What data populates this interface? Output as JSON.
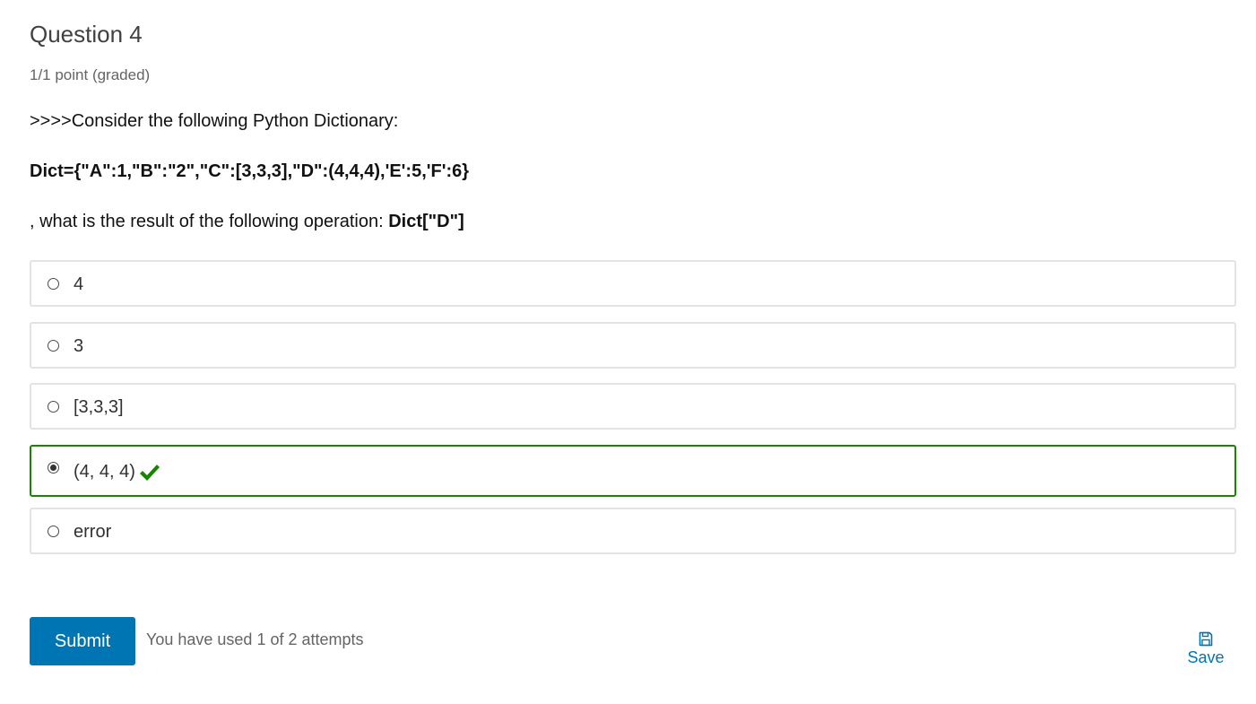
{
  "question": {
    "title": "Question 4",
    "points": "1/1 point (graded)",
    "intro": ">>>>Consider the following Python Dictionary:",
    "code": "Dict={\"A\":1,\"B\":\"2\",\"C\":[3,3,3],\"D\":(4,4,4),'E':5,'F':6}",
    "prompt_prefix": ", what is the result of the following operation: ",
    "prompt_expression": "Dict[\"D\"]"
  },
  "choices": [
    {
      "label": "4",
      "selected": false,
      "correct": false
    },
    {
      "label": "3",
      "selected": false,
      "correct": false
    },
    {
      "label": "[3,3,3]",
      "selected": false,
      "correct": false
    },
    {
      "label": "(4, 4, 4)",
      "selected": true,
      "correct": true
    },
    {
      "label": "error",
      "selected": false,
      "correct": false
    }
  ],
  "actions": {
    "submit_label": "Submit",
    "attempts_text": "You have used 1 of 2 attempts",
    "save_label": "Save"
  },
  "icons": {
    "correct": "check-icon",
    "save": "save-icon"
  },
  "colors": {
    "accent": "#0075b4",
    "correct": "#178500",
    "border": "#e3e3e3"
  }
}
